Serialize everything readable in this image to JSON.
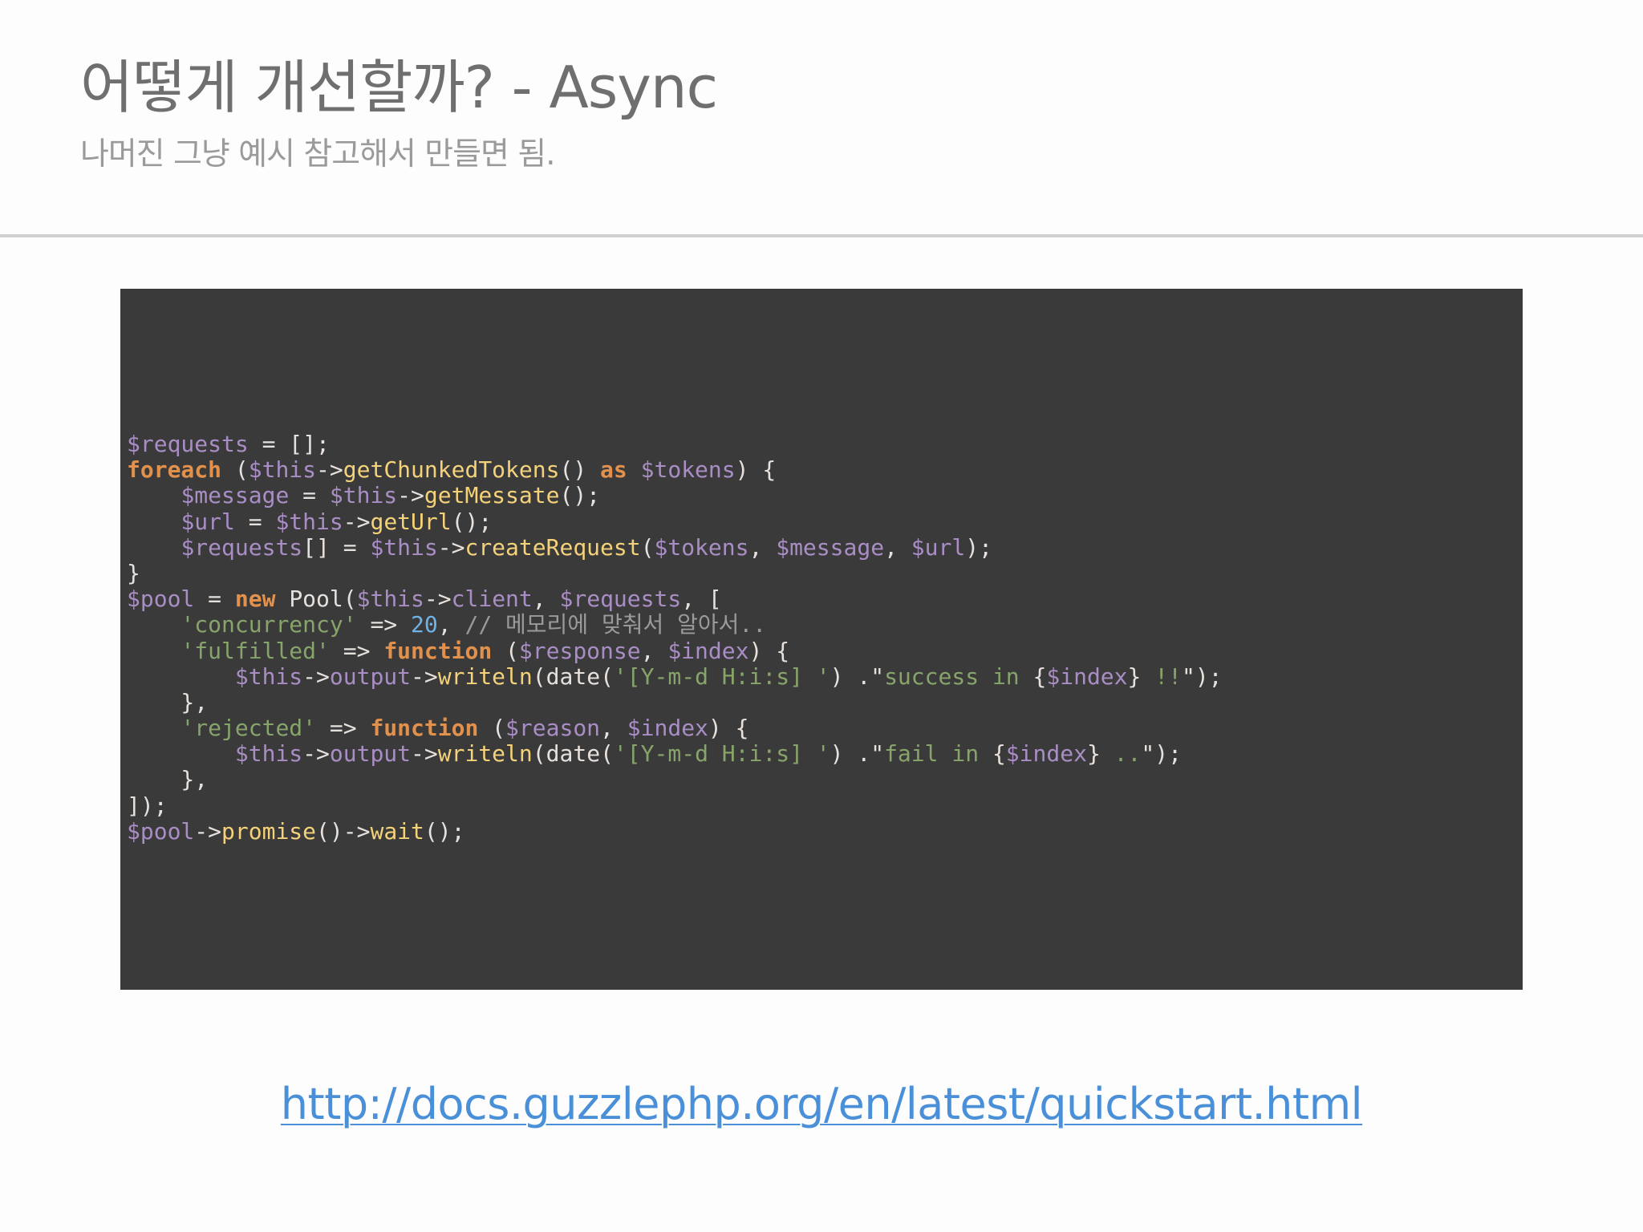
{
  "slide": {
    "title": "어떻게 개선할까?  - Async",
    "subtitle": "나머진 그냥 예시 참고해서 만들면 됨.",
    "link": "http://docs.guzzlephp.org/en/latest/quickstart.html"
  },
  "code": {
    "language": "php",
    "lines": [
      "$requests = [];",
      "foreach ($this->getChunkedTokens() as $tokens) {",
      "    $message = $this->getMessate();",
      "    $url = $this->getUrl();",
      "    $requests[] = $this->createRequest($tokens, $message, $url);",
      "}",
      "$pool = new Pool($this->client, $requests, [",
      "    'concurrency' => 20, // 메모리에 맞춰서 알아서..",
      "    'fulfilled' => function ($response, $index) {",
      "        $this->output->writeln(date('[Y-m-d H:i:s] ') .\"success in {$index} !!\");",
      "    },",
      "    'rejected' => function ($reason, $index) {",
      "        $this->output->writeln(date('[Y-m-d H:i:s] ') .\"fail in {$index} ..\");",
      "    },",
      "]);",
      "$pool->promise()->wait();"
    ]
  },
  "colors": {
    "code_background": "#3b3a3b",
    "variable": "#a98ec5",
    "keyword": "#e2914c",
    "function": "#f4d27a",
    "string": "#87a46b",
    "number": "#6fb3e6",
    "link": "#4a90d9"
  }
}
